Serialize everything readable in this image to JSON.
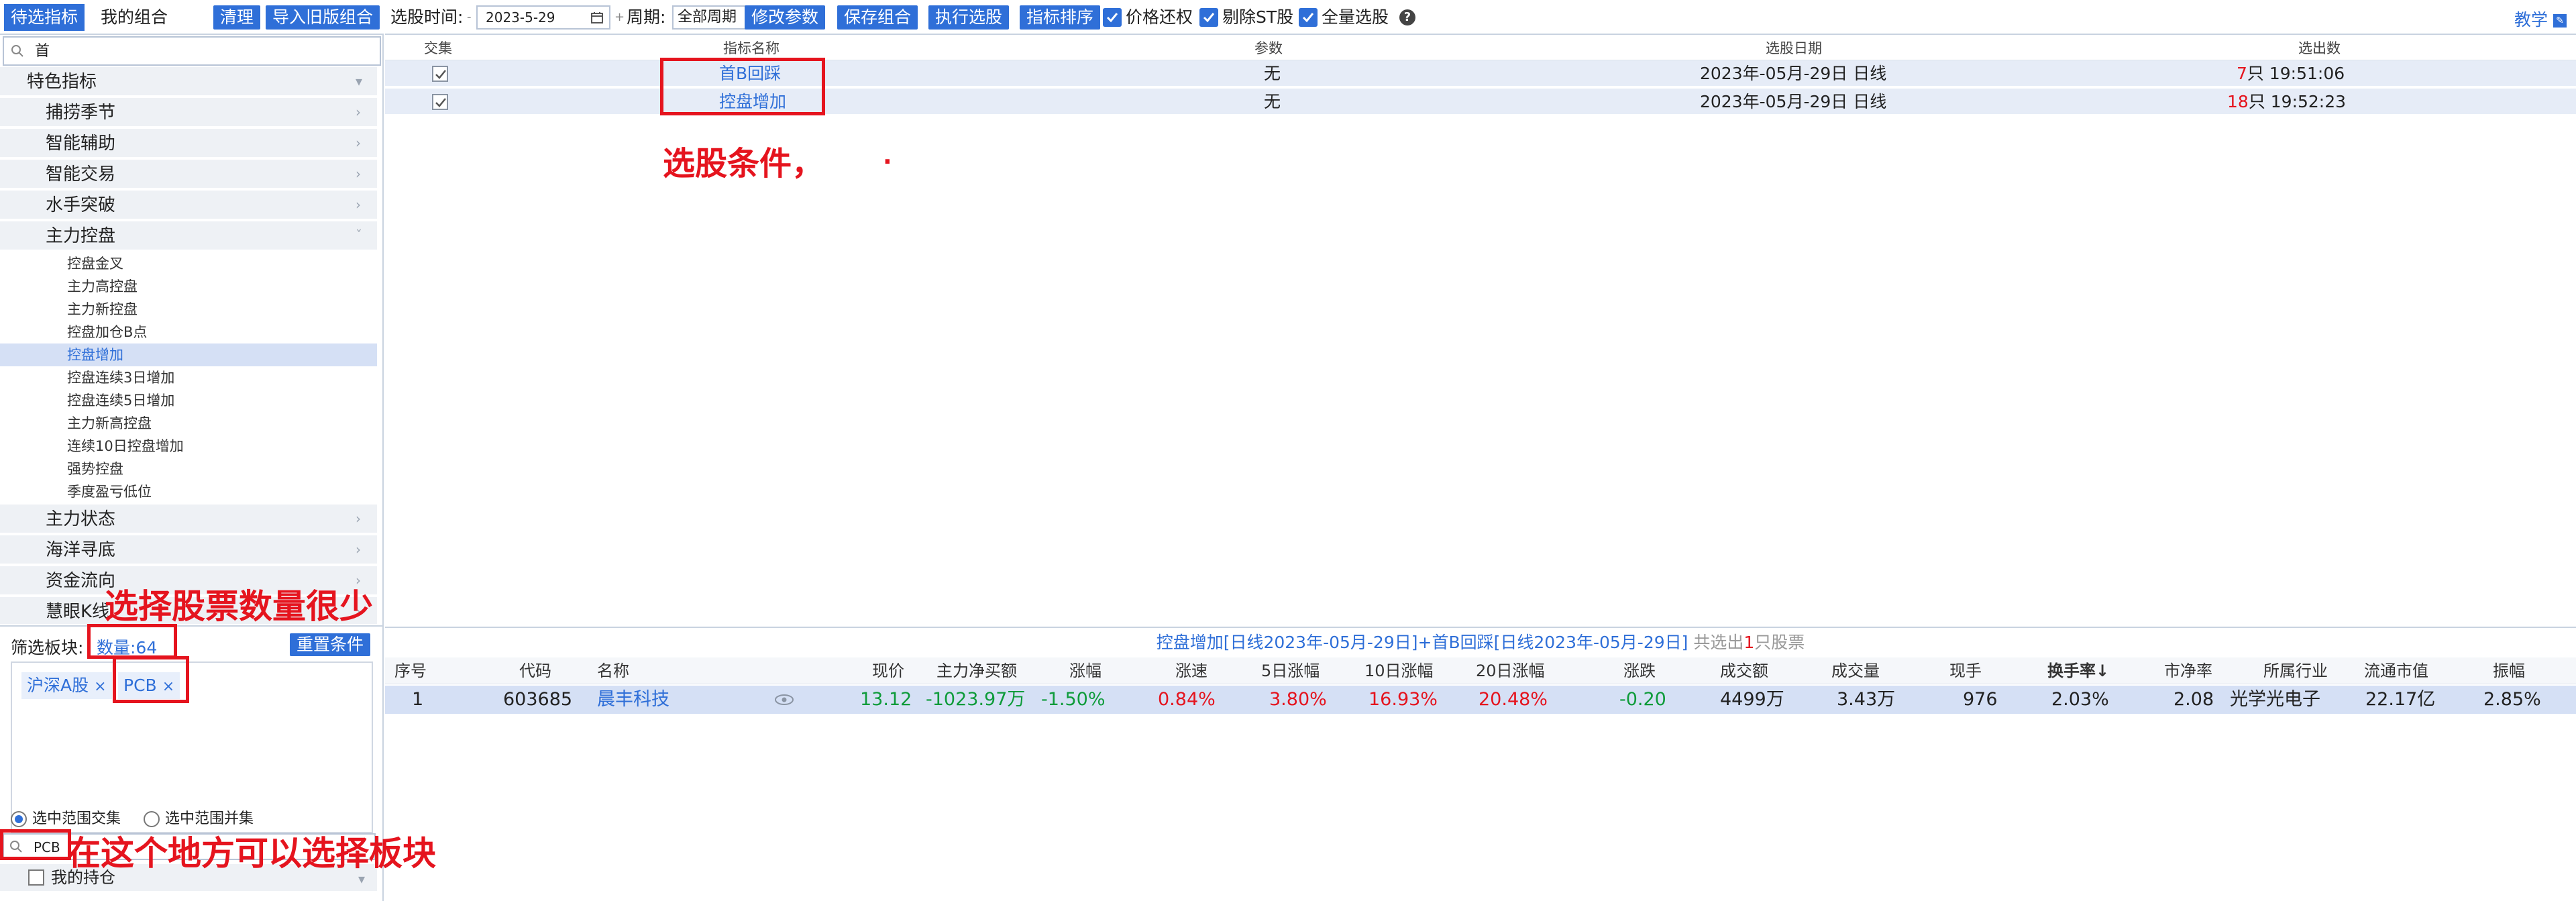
{
  "tabs": {
    "candidate": "待选指标",
    "my_combo": "我的组合"
  },
  "left_buttons": {
    "clear": "清理",
    "import_old": "导入旧版组合"
  },
  "search": {
    "value": "首"
  },
  "tree": {
    "top": "特色指标",
    "cats_before": [
      "捕捞季节",
      "智能辅助",
      "智能交易",
      "水手突破"
    ],
    "expanded": "主力控盘",
    "leaves": [
      "控盘金叉",
      "主力高控盘",
      "主力新控盘",
      "控盘加仓B点",
      "控盘增加",
      "控盘连续3日增加",
      "控盘连续5日增加",
      "主力新高控盘",
      "连续10日控盘增加",
      "强势控盘",
      "季度盈亏低位"
    ],
    "cats_after": [
      "主力状态",
      "海洋寻底",
      "资金流向",
      "慧眼K线"
    ]
  },
  "filter": {
    "title": "筛选板块:",
    "count": "数量:64",
    "reset": "重置条件",
    "chips": [
      "沪深A股",
      "PCB"
    ],
    "intersect": "选中范围交集",
    "union": "选中范围并集",
    "plate_search": "PCB",
    "holdings": "我的持仓"
  },
  "toolbar": {
    "time_label": "选股时间:",
    "date": "2023-5-29",
    "period_label": "周期:",
    "period": "全部周期",
    "modify": "修改参数",
    "save": "保存组合",
    "execute": "执行选股",
    "sort": "指标排序",
    "price_adj": "价格还权",
    "remove_st": "剔除ST股",
    "full": "全量选股",
    "help": "?",
    "teach": "教学"
  },
  "cond_table": {
    "headers": [
      "交集",
      "指标名称",
      "参数",
      "选股日期",
      "选出数"
    ],
    "rows": [
      {
        "name": "首B回踩",
        "param": "无",
        "date": "2023年-05月-29日 日线",
        "count": "7",
        "time": "只 19:51:06"
      },
      {
        "name": "控盘增加",
        "param": "无",
        "date": "2023年-05月-29日 日线",
        "count": "18",
        "time": "只 19:52:23"
      }
    ]
  },
  "annotations": {
    "cond": "选股条件，",
    "dot": ".",
    "few": "选择股票数量很少",
    "plate": "在这个地方可以选择板块"
  },
  "result": {
    "title_main": "控盘增加[日线2023年-05月-29日]+首B回踩[日线2023年-05月-29日]",
    "title_pre": " 共选出",
    "title_num": "1",
    "title_post": "只股票",
    "headers": [
      "序号",
      "代码",
      "名称",
      "现价",
      "主力净买额",
      "涨幅",
      "涨速",
      "5日涨幅",
      "10日涨幅",
      "20日涨幅",
      "涨跌",
      "成交额",
      "成交量",
      "现手",
      "换手率↓",
      "市净率",
      "所属行业",
      "流通市值",
      "振幅"
    ],
    "row": {
      "idx": "1",
      "code": "603685",
      "name": "晨丰科技",
      "price": "13.12",
      "net_buy": "-1023.97万",
      "chg": "-1.50%",
      "speed": "0.84%",
      "d5": "3.80%",
      "d10": "16.93%",
      "d20": "20.48%",
      "diff": "-0.20",
      "amount": "4499万",
      "volume": "3.43万",
      "hand": "976",
      "turnover": "2.03%",
      "pb": "2.08",
      "industry": "光学光电子",
      "mcap": "22.17亿",
      "amp": "2.85%"
    }
  }
}
